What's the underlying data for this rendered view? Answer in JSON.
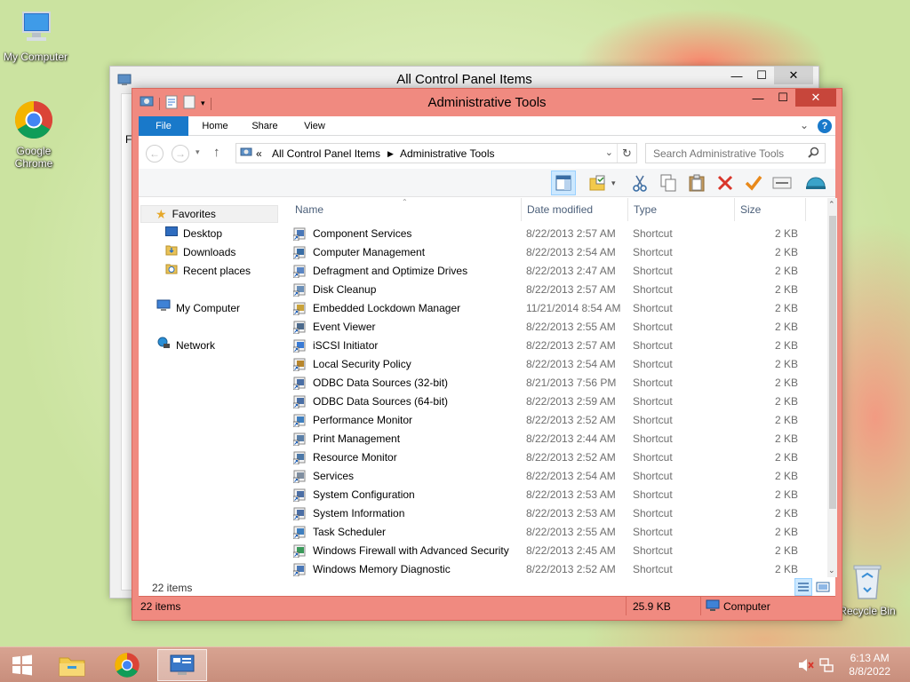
{
  "desktop": {
    "icons": [
      {
        "label": "My Computer"
      },
      {
        "label": "Google Chrome"
      },
      {
        "label": "Recycle Bin"
      }
    ]
  },
  "back_window": {
    "title": "All Control Panel Items",
    "partial_text": "Fi"
  },
  "window": {
    "title": "Administrative Tools",
    "caption": {
      "minimize": "—",
      "maximize": "☐",
      "close": "✕"
    },
    "ribbon_tabs": [
      "File",
      "Home",
      "Share",
      "View"
    ],
    "address": {
      "overflow": "«",
      "crumbs": [
        "All Control Panel Items",
        "Administrative Tools"
      ]
    },
    "search": {
      "placeholder": "Search Administrative Tools"
    },
    "nav_pane": {
      "favorites": "Favorites",
      "desktop": "Desktop",
      "downloads": "Downloads",
      "recent": "Recent places",
      "computer": "My Computer",
      "network": "Network"
    },
    "columns": {
      "name": "Name",
      "date": "Date modified",
      "type": "Type",
      "size": "Size"
    },
    "files": [
      {
        "name": "Component Services",
        "date": "8/22/2013 2:57 AM",
        "type": "Shortcut",
        "size": "2 KB"
      },
      {
        "name": "Computer Management",
        "date": "8/22/2013 2:54 AM",
        "type": "Shortcut",
        "size": "2 KB"
      },
      {
        "name": "Defragment and Optimize Drives",
        "date": "8/22/2013 2:47 AM",
        "type": "Shortcut",
        "size": "2 KB"
      },
      {
        "name": "Disk Cleanup",
        "date": "8/22/2013 2:57 AM",
        "type": "Shortcut",
        "size": "2 KB"
      },
      {
        "name": "Embedded Lockdown Manager",
        "date": "11/21/2014 8:54 AM",
        "type": "Shortcut",
        "size": "2 KB"
      },
      {
        "name": "Event Viewer",
        "date": "8/22/2013 2:55 AM",
        "type": "Shortcut",
        "size": "2 KB"
      },
      {
        "name": "iSCSI Initiator",
        "date": "8/22/2013 2:57 AM",
        "type": "Shortcut",
        "size": "2 KB"
      },
      {
        "name": "Local Security Policy",
        "date": "8/22/2013 2:54 AM",
        "type": "Shortcut",
        "size": "2 KB"
      },
      {
        "name": "ODBC Data Sources (32-bit)",
        "date": "8/21/2013 7:56 PM",
        "type": "Shortcut",
        "size": "2 KB"
      },
      {
        "name": "ODBC Data Sources (64-bit)",
        "date": "8/22/2013 2:59 AM",
        "type": "Shortcut",
        "size": "2 KB"
      },
      {
        "name": "Performance Monitor",
        "date": "8/22/2013 2:52 AM",
        "type": "Shortcut",
        "size": "2 KB"
      },
      {
        "name": "Print Management",
        "date": "8/22/2013 2:44 AM",
        "type": "Shortcut",
        "size": "2 KB"
      },
      {
        "name": "Resource Monitor",
        "date": "8/22/2013 2:52 AM",
        "type": "Shortcut",
        "size": "2 KB"
      },
      {
        "name": "Services",
        "date": "8/22/2013 2:54 AM",
        "type": "Shortcut",
        "size": "2 KB"
      },
      {
        "name": "System Configuration",
        "date": "8/22/2013 2:53 AM",
        "type": "Shortcut",
        "size": "2 KB"
      },
      {
        "name": "System Information",
        "date": "8/22/2013 2:53 AM",
        "type": "Shortcut",
        "size": "2 KB"
      },
      {
        "name": "Task Scheduler",
        "date": "8/22/2013 2:55 AM",
        "type": "Shortcut",
        "size": "2 KB"
      },
      {
        "name": "Windows Firewall with Advanced Security",
        "date": "8/22/2013 2:45 AM",
        "type": "Shortcut",
        "size": "2 KB"
      },
      {
        "name": "Windows Memory Diagnostic",
        "date": "8/22/2013 2:52 AM",
        "type": "Shortcut",
        "size": "2 KB"
      }
    ],
    "status_inner": "22 items",
    "status": {
      "items": "22 items",
      "size": "25.9 KB",
      "location": "Computer"
    }
  },
  "taskbar": {
    "time": "6:13 AM",
    "date": "8/8/2022"
  },
  "colors": {
    "accent": "#1979ca",
    "window_frame": "#f08a80",
    "close_button": "#c7463b"
  }
}
